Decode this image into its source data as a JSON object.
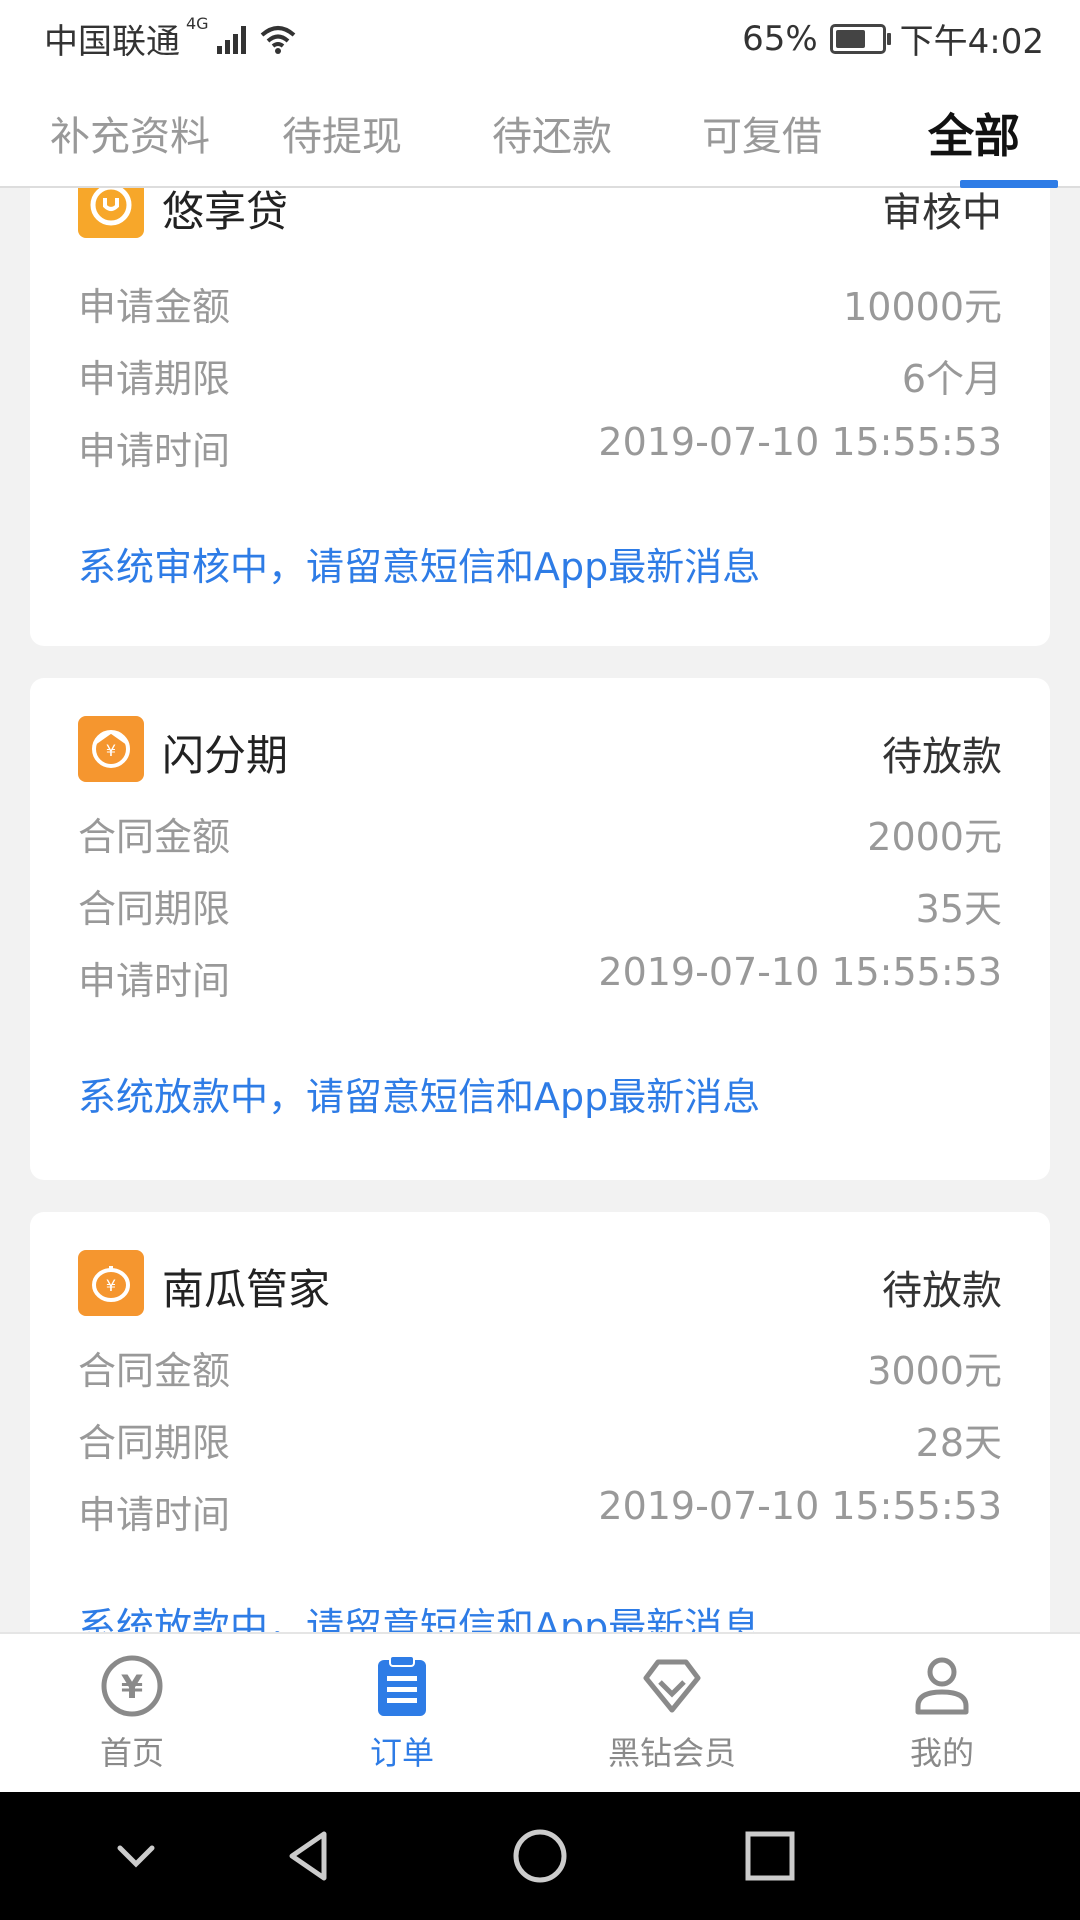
{
  "status_bar": {
    "carrier": "中国联通",
    "network": "4G",
    "battery_percent": "65%",
    "battery_level": 0.65,
    "time": "下午4:02"
  },
  "tabs": [
    {
      "label": "补充资料"
    },
    {
      "label": "待提现"
    },
    {
      "label": "待还款"
    },
    {
      "label": "可复借"
    },
    {
      "label": "全部"
    }
  ],
  "active_tab": "全部",
  "orders": [
    {
      "name": "悠享贷",
      "logo_icon": "smile-u-logo",
      "status": "审核中",
      "rows": [
        {
          "key": "申请金额",
          "value": "10000元"
        },
        {
          "key": "申请期限",
          "value": "6个月"
        },
        {
          "key": "申请时间",
          "value": "2019-07-10 15:55:53"
        }
      ],
      "notice": "系统审核中，请留意短信和App最新消息"
    },
    {
      "name": "闪分期",
      "logo_icon": "yuan-swirl-logo",
      "status": "待放款",
      "rows": [
        {
          "key": "合同金额",
          "value": "2000元"
        },
        {
          "key": "合同期限",
          "value": "35天"
        },
        {
          "key": "申请时间",
          "value": "2019-07-10 15:55:53"
        }
      ],
      "notice": "系统放款中，请留意短信和App最新消息"
    },
    {
      "name": "南瓜管家",
      "logo_icon": "pumpkin-yuan-logo",
      "status": "待放款",
      "rows": [
        {
          "key": "合同金额",
          "value": "3000元"
        },
        {
          "key": "合同期限",
          "value": "28天"
        },
        {
          "key": "申请时间",
          "value": "2019-07-10 15:55:53"
        }
      ],
      "notice": "系统放款中，请留意短信和App最新消息"
    }
  ],
  "bottom_nav": [
    {
      "label": "首页",
      "icon": "yuan-circle-icon"
    },
    {
      "label": "订单",
      "icon": "clipboard-list-icon"
    },
    {
      "label": "黑钻会员",
      "icon": "diamond-icon"
    },
    {
      "label": "我的",
      "icon": "person-icon"
    }
  ],
  "colors": {
    "accent": "#2e7ce6",
    "logo_orange": "#f5962f",
    "muted_text": "#999999"
  }
}
